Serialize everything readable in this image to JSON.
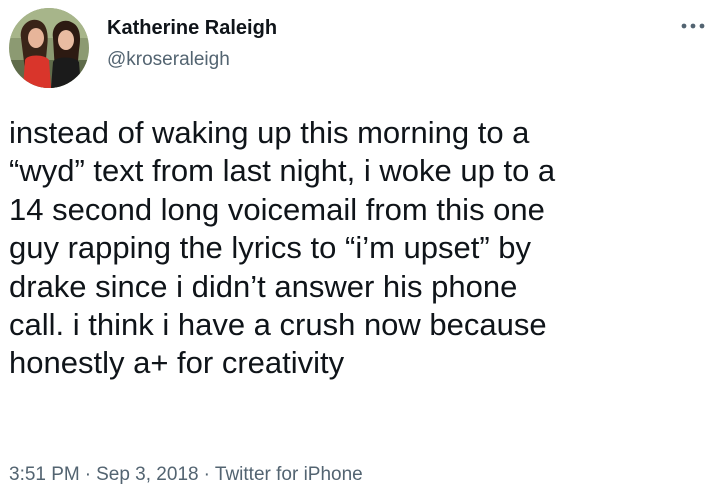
{
  "author": {
    "display_name": "Katherine Raleigh",
    "handle": "@kroseraleigh",
    "avatar_icon": "profile-photo"
  },
  "menu": {
    "more_icon": "more-horizontal-icon"
  },
  "tweet": {
    "text": "instead of waking up this morning to a\n“wyd” text from last night, i woke up to a\n14 second long voicemail from this one\nguy rapping the lyrics to “i’m upset” by\ndrake since i didn’t answer his phone\ncall. i think i have a crush now because\nhonestly a+ for creativity",
    "time": "3:51 PM",
    "date": "Sep 3, 2018",
    "source": "Twitter for iPhone",
    "separator": "·"
  },
  "colors": {
    "text": "#0f1419",
    "secondary": "#536471",
    "background": "#ffffff"
  }
}
